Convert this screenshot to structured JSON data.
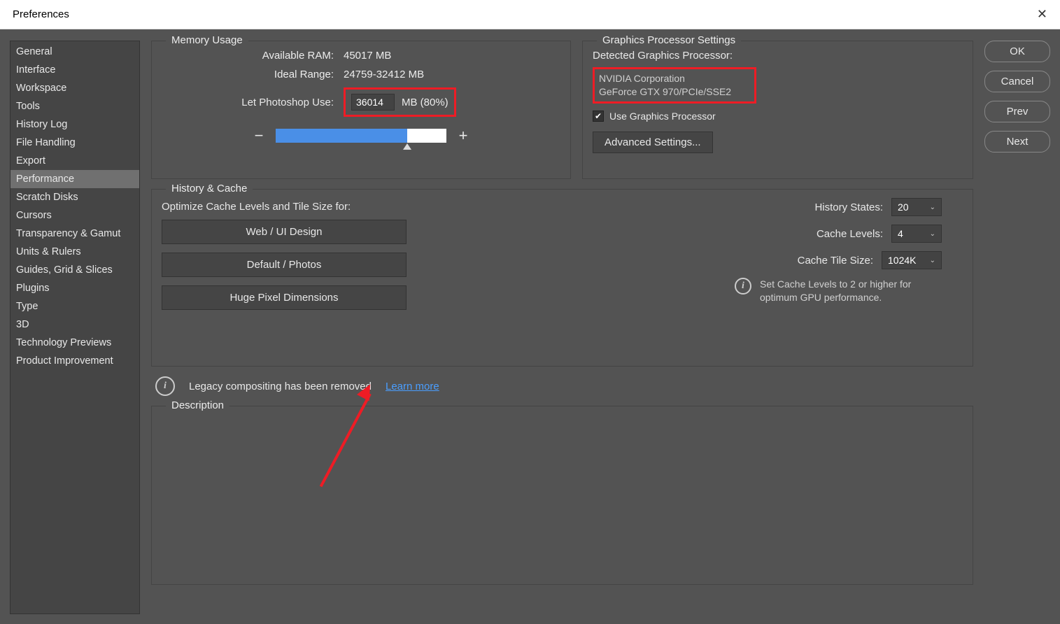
{
  "window": {
    "title": "Preferences"
  },
  "sidebar": {
    "items": [
      {
        "label": "General"
      },
      {
        "label": "Interface"
      },
      {
        "label": "Workspace"
      },
      {
        "label": "Tools"
      },
      {
        "label": "History Log"
      },
      {
        "label": "File Handling"
      },
      {
        "label": "Export"
      },
      {
        "label": "Performance",
        "selected": true
      },
      {
        "label": "Scratch Disks"
      },
      {
        "label": "Cursors"
      },
      {
        "label": "Transparency & Gamut"
      },
      {
        "label": "Units & Rulers"
      },
      {
        "label": "Guides, Grid & Slices"
      },
      {
        "label": "Plugins"
      },
      {
        "label": "Type"
      },
      {
        "label": "3D"
      },
      {
        "label": "Technology Previews"
      },
      {
        "label": "Product Improvement"
      }
    ]
  },
  "memory": {
    "title": "Memory Usage",
    "available_label": "Available RAM:",
    "available_value": "45017 MB",
    "ideal_label": "Ideal Range:",
    "ideal_value": "24759-32412 MB",
    "use_label": "Let Photoshop Use:",
    "use_value": "36014",
    "use_unit": "MB (80%)"
  },
  "gpu": {
    "title": "Graphics Processor Settings",
    "detected_label": "Detected Graphics Processor:",
    "vendor": "NVIDIA Corporation",
    "model": "GeForce GTX 970/PCIe/SSE2",
    "use_gpu_label": "Use Graphics Processor",
    "advanced_label": "Advanced Settings..."
  },
  "history": {
    "title": "History & Cache",
    "optimize_label": "Optimize Cache Levels and Tile Size for:",
    "preset1": "Web / UI Design",
    "preset2": "Default / Photos",
    "preset3": "Huge Pixel Dimensions",
    "states_label": "History States:",
    "states_value": "20",
    "levels_label": "Cache Levels:",
    "levels_value": "4",
    "tile_label": "Cache Tile Size:",
    "tile_value": "1024K",
    "info_text": "Set Cache Levels to 2 or higher for optimum GPU performance."
  },
  "legacy": {
    "text": "Legacy compositing has been removed",
    "link": "Learn more"
  },
  "description": {
    "title": "Description"
  },
  "buttons": {
    "ok": "OK",
    "cancel": "Cancel",
    "prev": "Prev",
    "next": "Next"
  }
}
